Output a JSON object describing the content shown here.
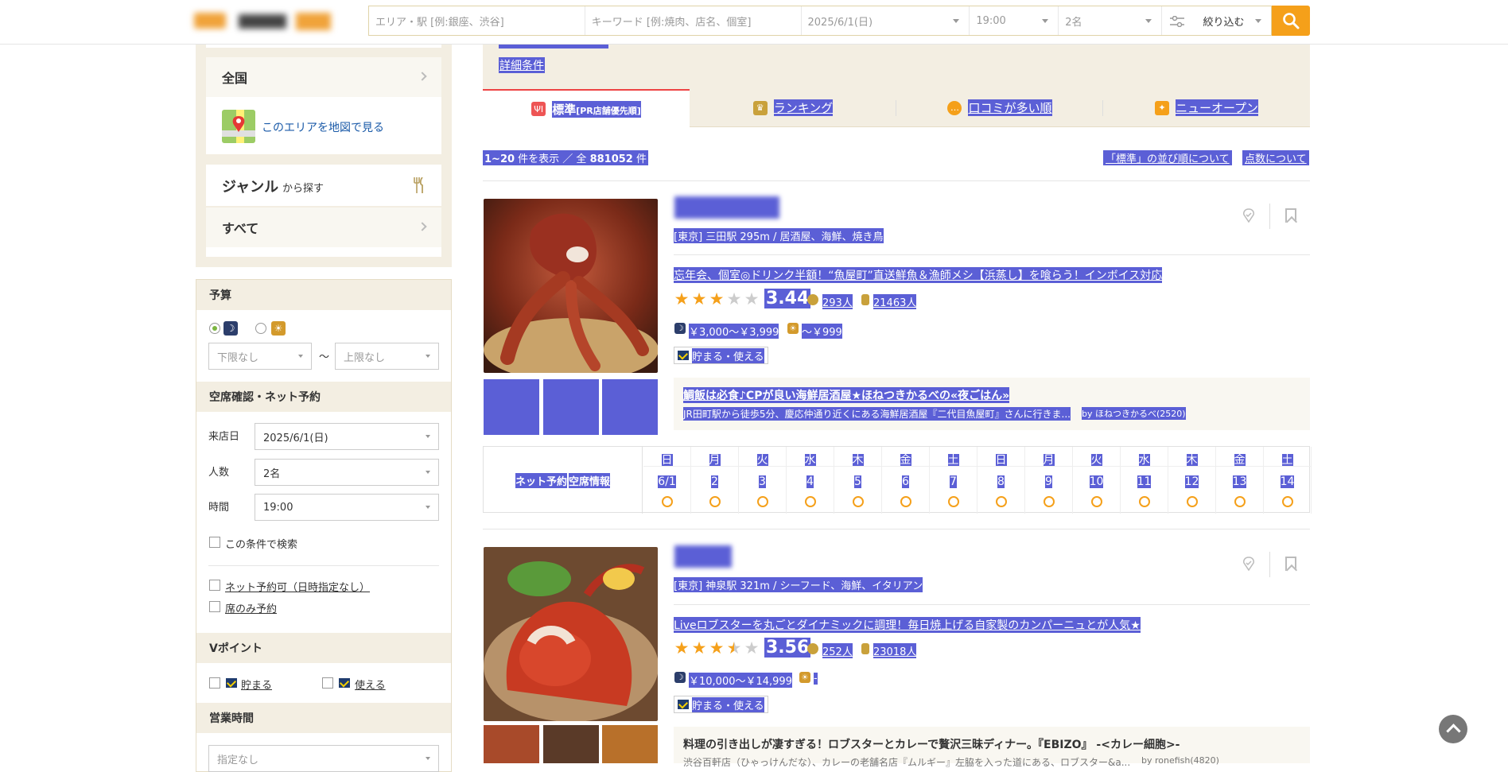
{
  "header": {
    "search": {
      "area_placeholder": "エリア・駅 [例:銀座、渋谷]",
      "keyword_placeholder": "キーワード [例:焼肉、店名、個室]",
      "date": "2025/6/1(日)",
      "time": "19:00",
      "people": "2名",
      "filter_label": "絞り込む"
    }
  },
  "sidebar": {
    "area_all": "全国",
    "map_link": "このエリアを地図で見る",
    "genre_title": "ジャンル",
    "genre_suffix": "から探す",
    "genre_all": "すべて",
    "budget": {
      "title": "予算",
      "min": "下限なし",
      "tilde": "〜",
      "max": "上限なし"
    },
    "reserve": {
      "title": "空席確認・ネット予約",
      "date_label": "来店日",
      "date_value": "2025/6/1(日)",
      "people_label": "人数",
      "people_value": "2名",
      "time_label": "時間",
      "time_value": "19:00",
      "search_condition": "この条件で検索",
      "net_ok": "ネット予約可（日時指定なし）",
      "seat_only": "席のみ予約"
    },
    "vpoint": {
      "title": "Vポイント",
      "earn": "貯まる",
      "use": "使える"
    },
    "hours": {
      "title": "営業時間",
      "value": "指定なし"
    }
  },
  "main": {
    "detail_link": "詳細条件",
    "tabs": [
      {
        "label": "標準",
        "sub": "[PR店舗優先順]"
      },
      {
        "label": "ランキング"
      },
      {
        "label": "口コミが多い順"
      },
      {
        "label": "ニューオープン"
      }
    ],
    "result": {
      "range": "1~20",
      "count_prefix": "件を表示 ／ 全",
      "total": "881052",
      "count_suffix": "件"
    },
    "sort_help": "「標準」の並び順について",
    "score_help": "点数について",
    "shops": [
      {
        "location": "[東京] 三田駅 295m / 居酒屋、海鮮、焼き鳥",
        "catch": "忘年会、個室◎ドリンク半額！“魚屋町”直送鮮魚＆漁師メシ【浜蒸し】を喰らう！インボイス対応",
        "rating": 3.44,
        "score": "3.44",
        "reviews": "293人",
        "saves": "21463人",
        "dinner_price": "￥3,000～￥3,999",
        "lunch_price": "～￥999",
        "vpoint": "貯まる・使える",
        "pr_title": "鯛飯は必食♪CPが良い海鮮居酒屋★ほねつきかるべの«夜ごはん»",
        "pr_body": "JR田町駅から徒歩5分、慶応仲通り近くにある海鮮居酒屋『二代目魚屋町』さんに行きま...",
        "pr_by": "by ほねつきかるべ(2520)"
      },
      {
        "location": "[東京] 神泉駅 321m / シーフード、海鮮、イタリアン",
        "catch": "Liveロブスターを丸ごとダイナミックに調理！毎日焼上げる自家製のカンパーニュとが人気★",
        "rating": 3.56,
        "score": "3.56",
        "reviews": "252人",
        "saves": "23018人",
        "dinner_price": "￥10,000～￥14,999",
        "lunch_price": "-",
        "vpoint": "貯まる・使える",
        "pr_title": "料理の引き出しが凄すぎる！ロブスターとカレーで贅沢三昧ディナー。『EBIZO』 -<カレー細胞>-",
        "pr_body": "渋谷百軒店（ひゃっけんだな）、カレーの老舗名店『ムルギー』左脇を入った道にある、ロブスター&a...",
        "pr_by": "by ronefish(4820)"
      }
    ],
    "calendar": {
      "label": "ネット予約",
      "label2": "空席情報",
      "weekdays": [
        "日",
        "月",
        "火",
        "水",
        "木",
        "金",
        "土",
        "日",
        "月",
        "火",
        "水",
        "木",
        "金",
        "土"
      ],
      "dates": [
        "6/1",
        "2",
        "3",
        "4",
        "5",
        "6",
        "7",
        "8",
        "9",
        "10",
        "11",
        "12",
        "13",
        "14"
      ]
    }
  }
}
